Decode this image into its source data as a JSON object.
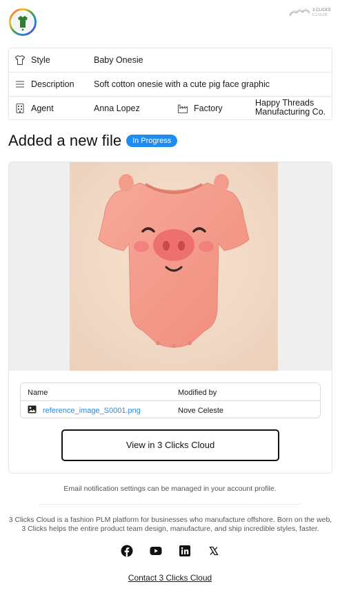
{
  "header": {
    "brand_text_line1": "3 CLICKS",
    "brand_text_line2": "CLOUD"
  },
  "info": {
    "style_label": "Style",
    "style_value": "Baby Onesie",
    "description_label": "Description",
    "description_value": "Soft cotton onesie with a cute pig face graphic",
    "agent_label": "Agent",
    "agent_value": "Anna Lopez",
    "factory_label": "Factory",
    "factory_value_line1": "Happy Threads",
    "factory_value_line2": "Manufacturing Co."
  },
  "main": {
    "title": "Added a new file",
    "status_badge": "In Progress",
    "status_color": "#1f8cf0"
  },
  "file_table": {
    "headers": [
      "Name",
      "Modified by"
    ],
    "rows": [
      {
        "name": "reference_image_S0001.png",
        "modified_by": "Nove Celeste"
      }
    ]
  },
  "actions": {
    "view_button": "View in 3 Clicks Cloud"
  },
  "footer": {
    "note": "Email notification settings can be managed in your account profile.",
    "about": "3 Clicks Cloud is a fashion PLM platform for businesses who manufacture offshore. Born on the web, 3 Clicks helps the entire product team design, manufacture, and ship incredible styles, faster.",
    "social_icons": [
      "facebook-icon",
      "youtube-icon",
      "linkedin-icon",
      "x-icon"
    ],
    "contact_link": "Contact 3 Clicks Cloud"
  }
}
